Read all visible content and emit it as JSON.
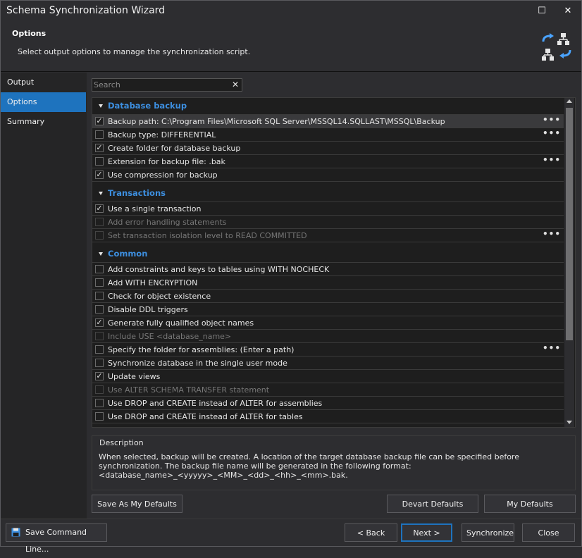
{
  "window": {
    "title": "Schema Synchronization Wizard",
    "maximize_glyph": "☐",
    "close_glyph": "✕"
  },
  "header": {
    "title": "Options",
    "subtitle": "Select output options to manage the synchronization script.",
    "icon": "schema-sync-icon",
    "accent": "#4aa3ff"
  },
  "sidebar": {
    "items": [
      {
        "label": "Output"
      },
      {
        "label": "Options"
      },
      {
        "label": "Summary"
      }
    ],
    "active_index": 1
  },
  "search": {
    "placeholder": "Search",
    "value": "",
    "clear_glyph": "✕"
  },
  "options": {
    "groups": [
      {
        "label": "Database backup"
      },
      {
        "label": "Transactions"
      },
      {
        "label": "Common"
      }
    ],
    "items": [
      {
        "label": "Backup path: C:\\Program Files\\Microsoft SQL Server\\MSSQL14.SQLLAST\\MSSQL\\Backup",
        "checked": true,
        "disabled": false,
        "has_more": true
      },
      {
        "label": "Backup type: DIFFERENTIAL",
        "checked": false,
        "disabled": false,
        "has_more": true
      },
      {
        "label": "Create folder for database backup",
        "checked": true,
        "disabled": false,
        "has_more": false
      },
      {
        "label": "Extension for backup file: .bak",
        "checked": false,
        "disabled": false,
        "has_more": true
      },
      {
        "label": "Use compression for backup",
        "checked": true,
        "disabled": false,
        "has_more": false
      },
      {
        "label": "Use a single transaction",
        "checked": true,
        "disabled": false,
        "has_more": false
      },
      {
        "label": "Add error handling statements",
        "checked": false,
        "disabled": true,
        "has_more": false
      },
      {
        "label": "Set transaction isolation level to READ COMMITTED",
        "checked": false,
        "disabled": true,
        "has_more": true
      },
      {
        "label": "Add constraints and keys to tables using WITH NOCHECK",
        "checked": false,
        "disabled": false,
        "has_more": false
      },
      {
        "label": "Add WITH ENCRYPTION",
        "checked": false,
        "disabled": false,
        "has_more": false
      },
      {
        "label": "Check for object existence",
        "checked": false,
        "disabled": false,
        "has_more": false
      },
      {
        "label": "Disable DDL triggers",
        "checked": false,
        "disabled": false,
        "has_more": false
      },
      {
        "label": "Generate fully qualified object names",
        "checked": true,
        "disabled": false,
        "has_more": false
      },
      {
        "label": "Include USE <database_name>",
        "checked": false,
        "disabled": true,
        "has_more": false
      },
      {
        "label": "Specify the folder for assemblies: (Enter a path)",
        "checked": false,
        "disabled": false,
        "has_more": true
      },
      {
        "label": "Synchronize database in the single user mode",
        "checked": false,
        "disabled": false,
        "has_more": false
      },
      {
        "label": "Update views",
        "checked": true,
        "disabled": false,
        "has_more": false
      },
      {
        "label": "Use ALTER SCHEMA TRANSFER statement",
        "checked": false,
        "disabled": true,
        "has_more": false
      },
      {
        "label": "Use DROP and CREATE instead of ALTER for assemblies",
        "checked": false,
        "disabled": false,
        "has_more": false
      },
      {
        "label": "Use DROP and CREATE instead of ALTER for tables",
        "checked": false,
        "disabled": false,
        "has_more": false
      }
    ],
    "check_glyph": "✓",
    "more_glyph": "•••"
  },
  "description": {
    "title": "Description",
    "text": "When selected, backup will be created. A location of the target database backup file can be specified before synchronization. The backup file name will be generated in the following format: <database_name>_<yyyyy>_<MM>_<dd>_<hh>_<mm>.bak."
  },
  "buttons": {
    "save_as_defaults": "Save As My Defaults",
    "devart_defaults": "Devart Defaults",
    "my_defaults": "My Defaults",
    "save_command_line": "Save Command Line...",
    "back": "< Back",
    "next": "Next >",
    "synchronize": "Synchronize",
    "close": "Close"
  }
}
